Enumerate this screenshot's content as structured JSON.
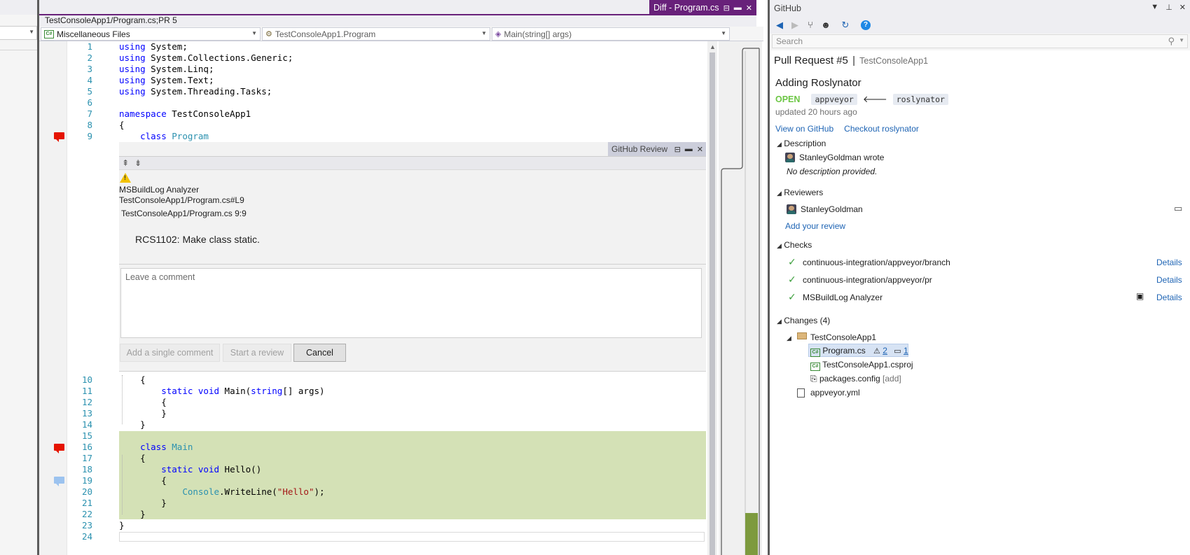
{
  "editor": {
    "doc_tab": "Diff - Program.cs",
    "path": "TestConsoleApp1/Program.cs;PR 5",
    "nav": {
      "project": "Miscellaneous Files",
      "type": "TestConsoleApp1.Program",
      "member": "Main(string[] args)"
    },
    "lines_top": [
      {
        "n": "1",
        "tokens": [
          {
            "t": "using",
            "c": "kw"
          },
          {
            "t": " System;",
            "c": ""
          }
        ]
      },
      {
        "n": "2",
        "tokens": [
          {
            "t": "using",
            "c": "kw"
          },
          {
            "t": " System.Collections.Generic;",
            "c": ""
          }
        ]
      },
      {
        "n": "3",
        "tokens": [
          {
            "t": "using",
            "c": "kw"
          },
          {
            "t": " System.Linq;",
            "c": ""
          }
        ]
      },
      {
        "n": "4",
        "tokens": [
          {
            "t": "using",
            "c": "kw"
          },
          {
            "t": " System.Text;",
            "c": ""
          }
        ]
      },
      {
        "n": "5",
        "tokens": [
          {
            "t": "using",
            "c": "kw"
          },
          {
            "t": " System.Threading.Tasks;",
            "c": ""
          }
        ]
      },
      {
        "n": "6",
        "tokens": []
      },
      {
        "n": "7",
        "tokens": [
          {
            "t": "namespace",
            "c": "kw"
          },
          {
            "t": " TestConsoleApp1",
            "c": ""
          }
        ]
      },
      {
        "n": "8",
        "tokens": [
          {
            "t": "{",
            "c": ""
          }
        ]
      },
      {
        "n": "9",
        "tokens": [
          {
            "t": "    ",
            "c": ""
          },
          {
            "t": "class",
            "c": "kw"
          },
          {
            "t": " ",
            "c": ""
          },
          {
            "t": "Program",
            "c": "ty"
          }
        ]
      }
    ],
    "lines_bottom": [
      {
        "n": "10",
        "tokens": [
          {
            "t": "    {",
            "c": ""
          }
        ]
      },
      {
        "n": "11",
        "tokens": [
          {
            "t": "        ",
            "c": ""
          },
          {
            "t": "static",
            "c": "kw"
          },
          {
            "t": " ",
            "c": ""
          },
          {
            "t": "void",
            "c": "kw"
          },
          {
            "t": " Main(",
            "c": ""
          },
          {
            "t": "string",
            "c": "kw"
          },
          {
            "t": "[] args)",
            "c": ""
          }
        ]
      },
      {
        "n": "12",
        "tokens": [
          {
            "t": "        {",
            "c": ""
          }
        ]
      },
      {
        "n": "13",
        "tokens": [
          {
            "t": "        }",
            "c": ""
          }
        ]
      },
      {
        "n": "14",
        "tokens": [
          {
            "t": "    }",
            "c": ""
          }
        ]
      },
      {
        "n": "15",
        "tokens": []
      },
      {
        "n": "16",
        "tokens": [
          {
            "t": "    ",
            "c": ""
          },
          {
            "t": "class",
            "c": "kw"
          },
          {
            "t": " ",
            "c": ""
          },
          {
            "t": "Main",
            "c": "ty"
          }
        ]
      },
      {
        "n": "17",
        "tokens": [
          {
            "t": "    {",
            "c": ""
          }
        ]
      },
      {
        "n": "18",
        "tokens": [
          {
            "t": "        ",
            "c": ""
          },
          {
            "t": "static",
            "c": "kw"
          },
          {
            "t": " ",
            "c": ""
          },
          {
            "t": "void",
            "c": "kw"
          },
          {
            "t": " Hello()",
            "c": ""
          }
        ]
      },
      {
        "n": "19",
        "tokens": [
          {
            "t": "        {",
            "c": ""
          }
        ]
      },
      {
        "n": "20",
        "tokens": [
          {
            "t": "            ",
            "c": ""
          },
          {
            "t": "Console",
            "c": "ty"
          },
          {
            "t": ".WriteLine(",
            "c": ""
          },
          {
            "t": "\"Hello\"",
            "c": "str"
          },
          {
            "t": ");",
            "c": ""
          }
        ]
      },
      {
        "n": "21",
        "tokens": [
          {
            "t": "        }",
            "c": ""
          }
        ]
      },
      {
        "n": "22",
        "tokens": [
          {
            "t": "    }",
            "c": ""
          }
        ]
      },
      {
        "n": "23",
        "tokens": [
          {
            "t": "}",
            "c": ""
          }
        ]
      },
      {
        "n": "24",
        "tokens": []
      }
    ]
  },
  "review": {
    "tab_title": "GitHub Review",
    "analyzer": "MSBuildLog Analyzer",
    "location_link": "TestConsoleApp1/Program.cs#L9",
    "position": "TestConsoleApp1/Program.cs 9:9",
    "message": "RCS1102: Make class static.",
    "comment_placeholder": "Leave a comment",
    "buttons": {
      "single": "Add a single comment",
      "start": "Start a review",
      "cancel": "Cancel"
    }
  },
  "github": {
    "pane_title": "GitHub",
    "search_placeholder": "Search",
    "pr_title": "Pull Request #5",
    "pr_repo": "TestConsoleApp1",
    "pr_name": "Adding Roslynator",
    "state": "OPEN",
    "base_branch": "appveyor",
    "head_branch": "roslynator",
    "updated": "updated 20 hours ago",
    "links": {
      "view": "View on GitHub",
      "checkout": "Checkout roslynator"
    },
    "description": {
      "header": "Description",
      "author": "StanleyGoldman",
      "wrote": "wrote",
      "body": "No description provided."
    },
    "reviewers": {
      "header": "Reviewers",
      "items": [
        "StanleyGoldman"
      ],
      "add_review": "Add your review"
    },
    "checks": {
      "header": "Checks",
      "details_label": "Details",
      "items": [
        "continuous-integration/appveyor/branch",
        "continuous-integration/appveyor/pr",
        "MSBuildLog Analyzer"
      ]
    },
    "changes": {
      "header": "Changes (4)",
      "folder": "TestConsoleApp1",
      "files": [
        {
          "name": "Program.cs",
          "warnings": "2",
          "comments": "1"
        },
        {
          "name": "TestConsoleApp1.csproj"
        },
        {
          "name": "packages.config",
          "tag": "[add]"
        },
        {
          "name": "appveyor.yml"
        }
      ]
    }
  },
  "colors": {
    "accent": "#68217a",
    "added_line": "#d4e1b6",
    "comment_marker": "#e51400",
    "open_state": "#6cc644",
    "link": "#1e64b4"
  }
}
